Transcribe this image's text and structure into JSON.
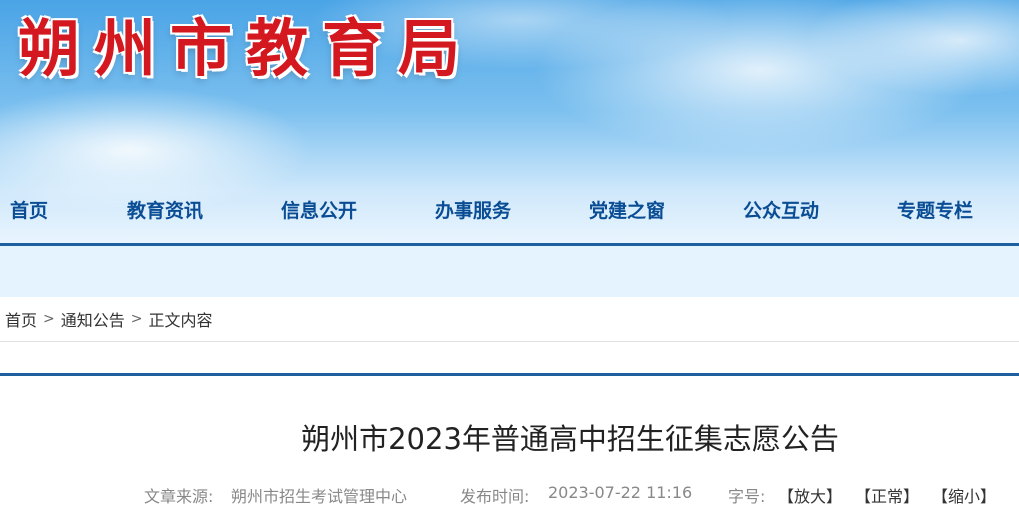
{
  "header": {
    "site_title": "朔州市教育局"
  },
  "nav": {
    "items": [
      {
        "label": "首页"
      },
      {
        "label": "教育资讯"
      },
      {
        "label": "信息公开"
      },
      {
        "label": "办事服务"
      },
      {
        "label": "党建之窗"
      },
      {
        "label": "公众互动"
      },
      {
        "label": "专题专栏"
      }
    ]
  },
  "breadcrumb": {
    "home": "首页",
    "separator": ">",
    "section": "通知公告",
    "current": "正文内容"
  },
  "article": {
    "title": "朔州市2023年普通高中招生征集志愿公告",
    "source_label": "文章来源:",
    "source_value": "朔州市招生考试管理中心",
    "publish_label": "发布时间:",
    "publish_value": "2023-07-22 11:16",
    "font_label": "字号:",
    "font_larger": "【放大】",
    "font_normal": "【正常】",
    "font_smaller": "【缩小】"
  },
  "colors": {
    "title_red": "#d4181f",
    "nav_blue": "#0a4d94",
    "rule_blue": "#1e5f9e",
    "band_light_blue": "#e4f3fd"
  }
}
